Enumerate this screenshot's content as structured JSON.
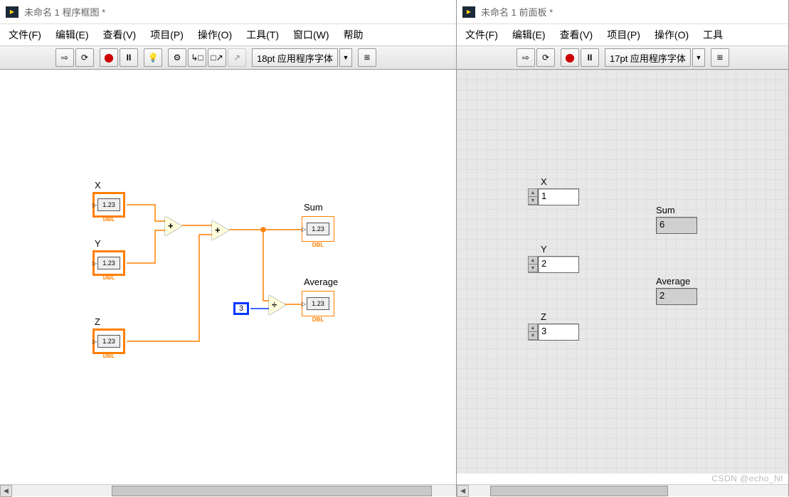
{
  "left_window": {
    "title": "未命名 1 程序框图 *",
    "menu": [
      "文件(F)",
      "编辑(E)",
      "查看(V)",
      "项目(P)",
      "操作(O)",
      "工具(T)",
      "窗口(W)",
      "帮助"
    ],
    "font": "18pt 应用程序字体",
    "labels": {
      "x": "X",
      "y": "Y",
      "z": "Z",
      "sum": "Sum",
      "avg": "Average"
    },
    "constant3": "3",
    "terminal_display": "1.23",
    "dbl_tag": "DBL"
  },
  "right_window": {
    "title": "未命名 1 前面板 *",
    "menu": [
      "文件(F)",
      "编辑(E)",
      "查看(V)",
      "项目(P)",
      "操作(O)",
      "工具"
    ],
    "font": "17pt 应用程序字体",
    "controls": {
      "x": {
        "label": "X",
        "value": "1"
      },
      "y": {
        "label": "Y",
        "value": "2"
      },
      "z": {
        "label": "Z",
        "value": "3"
      }
    },
    "indicators": {
      "sum": {
        "label": "Sum",
        "value": "6"
      },
      "avg": {
        "label": "Average",
        "value": "2"
      }
    }
  },
  "watermark": "CSDN @echo_NI"
}
